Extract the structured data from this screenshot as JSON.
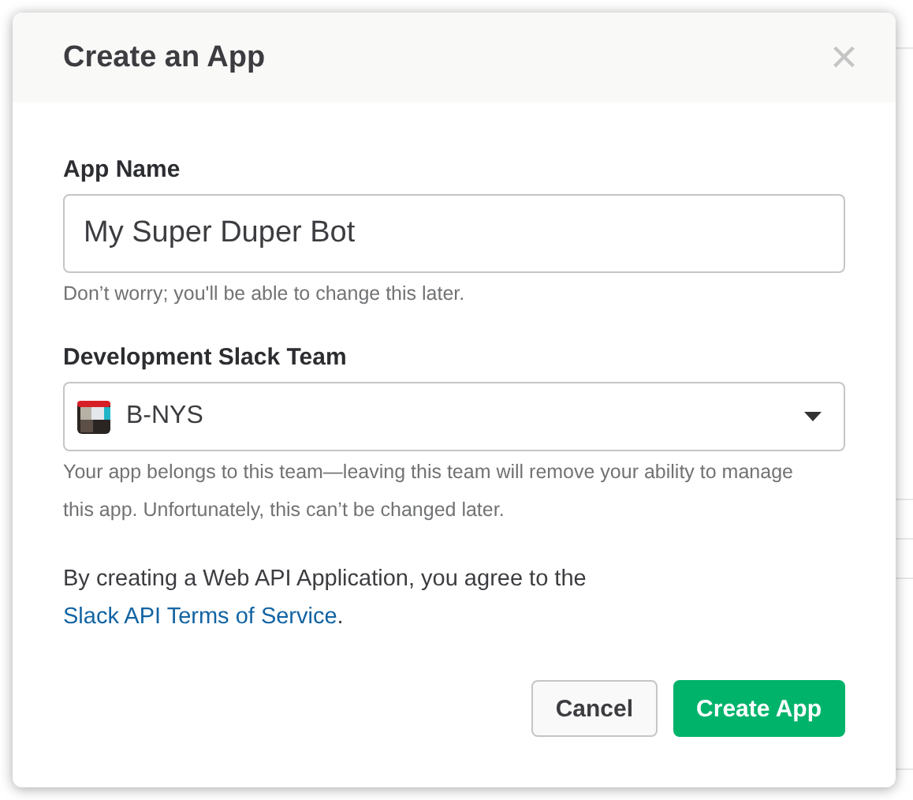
{
  "modal": {
    "title": "Create an App",
    "close": "×",
    "app_name": {
      "label": "App Name",
      "value": "My Super Duper Bot",
      "hint": "Don’t worry; you'll be able to change this later."
    },
    "team": {
      "label": "Development Slack Team",
      "value": "B-NYS",
      "hint": "Your app belongs to this team—leaving this team will remove your ability to manage this app. Unfortunately, this can’t be changed later."
    },
    "terms": {
      "text": "By creating a Web API Application, you agree to the",
      "link": "Slack API Terms of Service",
      "end": "."
    },
    "buttons": [
      {
        "label": "Cancel",
        "kind": "secondary"
      },
      {
        "label": "Create App",
        "kind": "primary"
      }
    ]
  }
}
